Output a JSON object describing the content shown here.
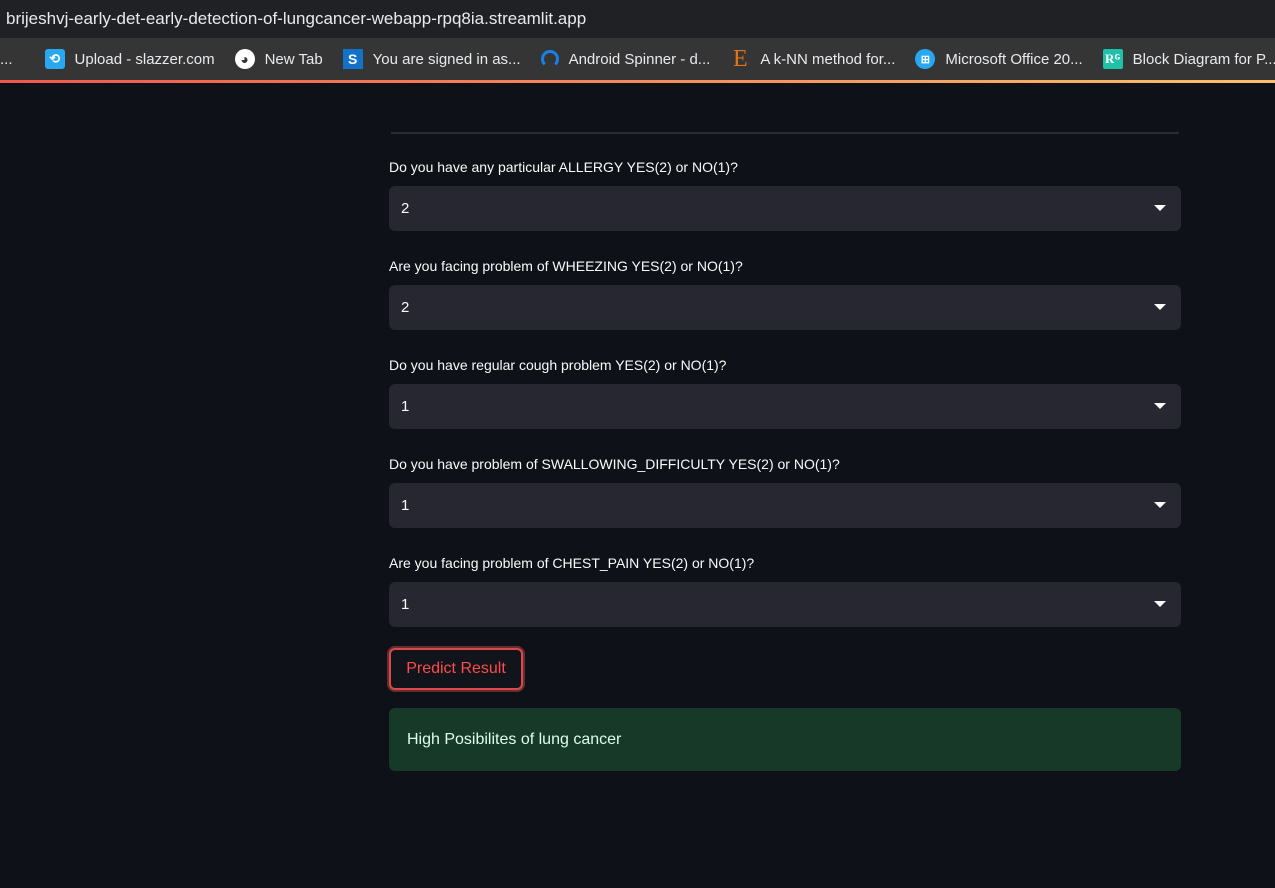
{
  "browser": {
    "url": "brijeshvj-early-det-early-detection-of-lungcancer-webapp-rpq8ia.streamlit.app",
    "bookmarks_lead": "...",
    "bookmarks": [
      {
        "label": "Upload - slazzer.com",
        "icon": "slazzer-icon"
      },
      {
        "label": "New Tab",
        "icon": "globe-icon"
      },
      {
        "label": "You are signed in as...",
        "icon": "s-logo-icon"
      },
      {
        "label": "Android Spinner - d...",
        "icon": "spinner-logo-icon"
      },
      {
        "label": "A k-NN method for...",
        "icon": "elsevier-icon"
      },
      {
        "label": "Microsoft Office 20...",
        "icon": "windows-icon"
      },
      {
        "label": "Block Diagram for P...",
        "icon": "researchgate-icon"
      }
    ],
    "icon_glyphs": {
      "slazzer": "⟲",
      "globe": "◕",
      "s": "S",
      "e": "E",
      "win": "⊞",
      "rg": "Rᴳ"
    }
  },
  "form": {
    "fields": [
      {
        "label": "Do you have any particular ALLERGY YES(2) or NO(1)?",
        "value": "2"
      },
      {
        "label": "Are you facing problem of WHEEZING YES(2) or NO(1)?",
        "value": "2"
      },
      {
        "label": "Do you have regular cough problem YES(2) or NO(1)?",
        "value": "1"
      },
      {
        "label": "Do you have problem of SWALLOWING_DIFFICULTY YES(2) or NO(1)?",
        "value": "1"
      },
      {
        "label": "Are you facing problem of CHEST_PAIN YES(2) or NO(1)?",
        "value": "1"
      }
    ],
    "predict_label": "Predict Result"
  },
  "result": {
    "text": "High Posibilites of lung cancer",
    "status": "success"
  },
  "colors": {
    "background": "#0e1117",
    "select_bg": "#262730",
    "accent_red": "#ff4b4b",
    "success_bg": "#173928",
    "success_text": "#dffde9"
  }
}
